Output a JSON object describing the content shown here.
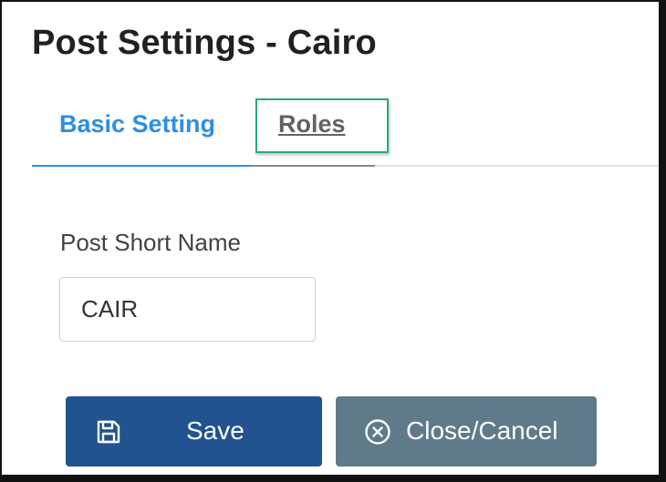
{
  "page": {
    "title": "Post Settings - Cairo"
  },
  "tabs": [
    {
      "label": "Basic Setting",
      "active": true
    },
    {
      "label": "Roles",
      "active": false,
      "highlighted": true
    }
  ],
  "form": {
    "post_short_name": {
      "label": "Post Short Name",
      "value": "CAIR"
    }
  },
  "buttons": {
    "save": {
      "label": "Save",
      "icon": "floppy-disk-icon"
    },
    "cancel": {
      "label": "Close/Cancel",
      "icon": "circle-x-icon"
    }
  },
  "colors": {
    "active_tab": "#2d8fe3",
    "highlight_box": "#2aa884",
    "save_button": "#20538f",
    "cancel_button": "#5f7a88"
  }
}
